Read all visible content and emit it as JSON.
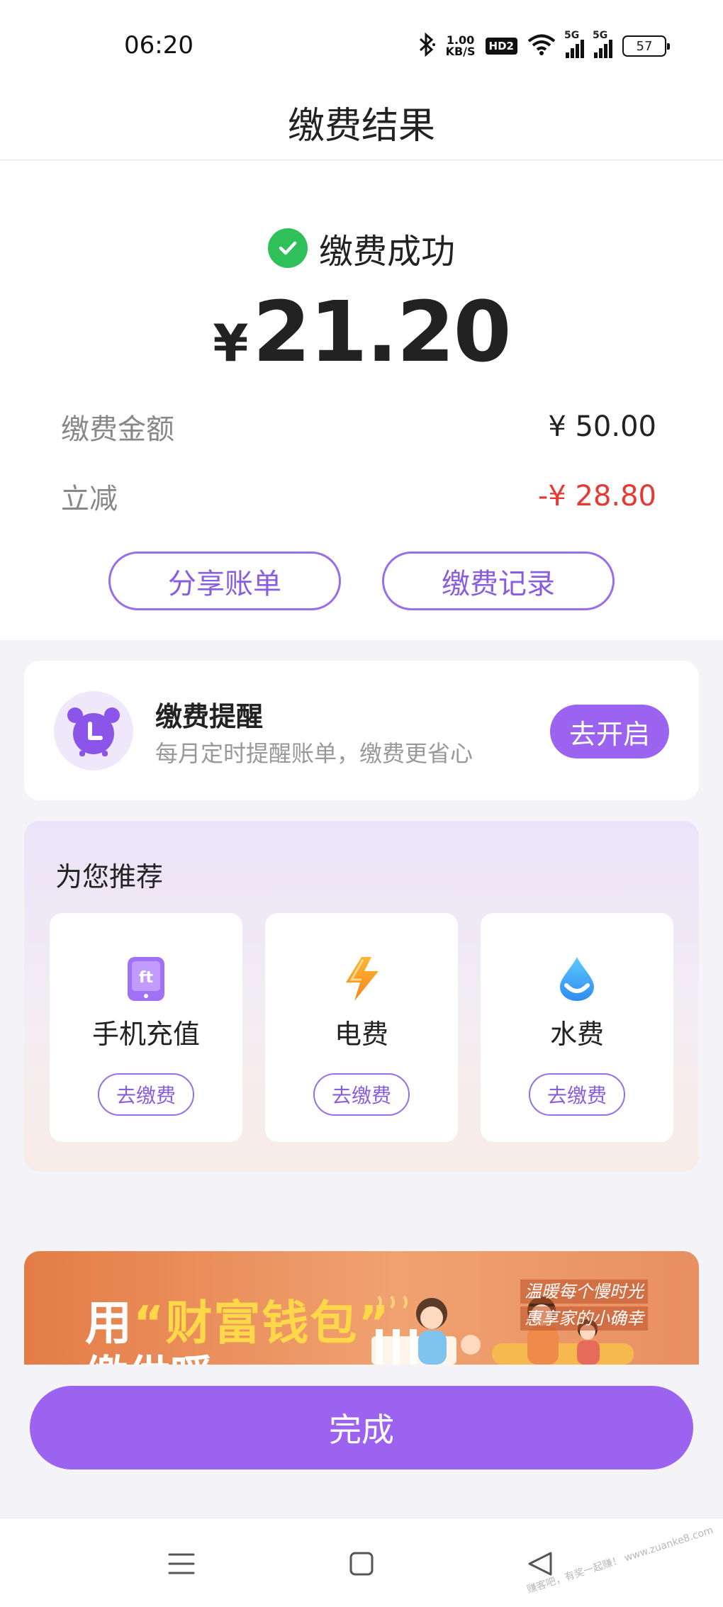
{
  "status_bar": {
    "time": "06:20",
    "net_speed_value": "1.00",
    "net_speed_unit": "KB/S",
    "hd_label": "HD2",
    "signal_label_1": "5G",
    "signal_label_2": "5G",
    "battery": "57"
  },
  "header": {
    "title": "缴费结果"
  },
  "result": {
    "status_text": "缴费成功",
    "currency_symbol": "¥",
    "amount": "21.20",
    "rows": [
      {
        "label": "缴费金额",
        "value": "¥ 50.00"
      },
      {
        "label": "立减",
        "value": "-¥ 28.80"
      }
    ],
    "share_button": "分享账单",
    "records_button": "缴费记录"
  },
  "reminder": {
    "title": "缴费提醒",
    "subtitle": "每月定时提醒账单，缴费更省心",
    "button": "去开启"
  },
  "recommend": {
    "title": "为您推荐",
    "items": [
      {
        "name": "手机充值",
        "button": "去缴费",
        "icon": "phone-icon"
      },
      {
        "name": "电费",
        "button": "去缴费",
        "icon": "lightning-icon"
      },
      {
        "name": "水费",
        "button": "去缴费",
        "icon": "water-drop-icon"
      }
    ]
  },
  "banner": {
    "prefix": "用",
    "quote_open": "“",
    "highlight": "财富钱包",
    "quote_close": "”",
    "line2": "缴供暖",
    "slogan_1": "温暖每个慢时光",
    "slogan_2": "惠享家的小确幸"
  },
  "done_button": "完成",
  "watermark": "赚客吧，有奖一起赚！ www.zuanke8.com",
  "colors": {
    "accent": "#9b63f0",
    "success": "#2fc05a",
    "discount": "#e53935"
  }
}
